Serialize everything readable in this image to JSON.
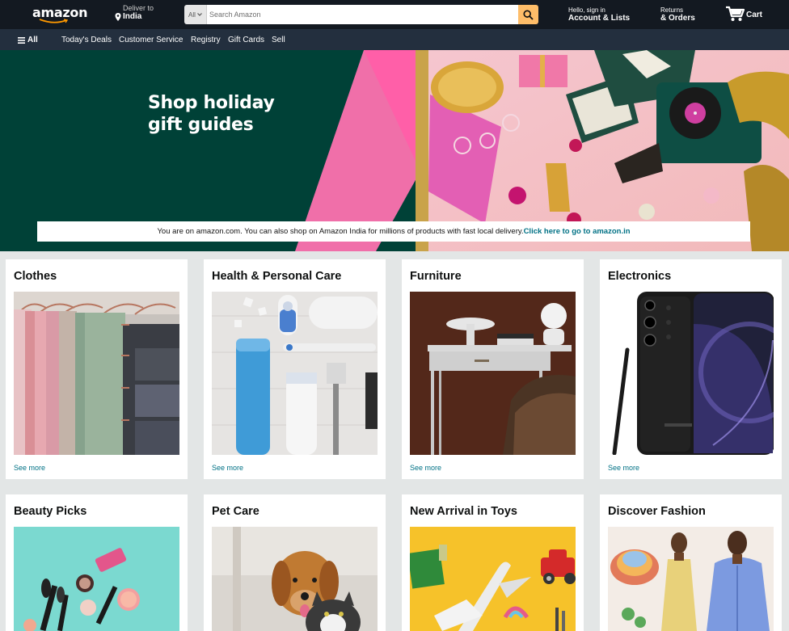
{
  "header": {
    "logo_text": "amazon",
    "deliver_to_label": "Deliver to",
    "deliver_to_location": "India",
    "search": {
      "category": "All",
      "placeholder": "Search Amazon"
    },
    "account_greeting": "Hello, sign in",
    "account_label": "Account & Lists",
    "returns_label": "Returns",
    "orders_label": "& Orders",
    "cart_label": "Cart",
    "cart_count": "0"
  },
  "subnav": {
    "all_label": "All",
    "items": [
      "Today's Deals",
      "Customer Service",
      "Registry",
      "Gift Cards",
      "Sell"
    ]
  },
  "hero": {
    "title_line1": "Shop holiday",
    "title_line2": "gift guides",
    "banner_text": "You are on amazon.com. You can also shop on Amazon India for millions of products with fast local delivery.",
    "banner_link": "Click here to go to amazon.in"
  },
  "cards": [
    {
      "title": "Clothes",
      "link": "See more"
    },
    {
      "title": "Health & Personal Care",
      "link": "See more"
    },
    {
      "title": "Furniture",
      "link": "See more"
    },
    {
      "title": "Electronics",
      "link": "See more"
    },
    {
      "title": "Beauty Picks"
    },
    {
      "title": "Pet Care"
    },
    {
      "title": "New Arrival in Toys"
    },
    {
      "title": "Discover Fashion"
    }
  ],
  "colors": {
    "nav_top": "#131921",
    "nav_sub": "#232f3e",
    "search_button": "#febd69",
    "hero_green": "#004137",
    "hero_pink": "#f06fa9",
    "link": "#007185",
    "page_bg": "#e3e6e6"
  },
  "icons": [
    "amazon-smile-logo",
    "location-pin-icon",
    "chevron-down-icon",
    "search-icon",
    "cart-icon",
    "hamburger-menu-icon"
  ]
}
